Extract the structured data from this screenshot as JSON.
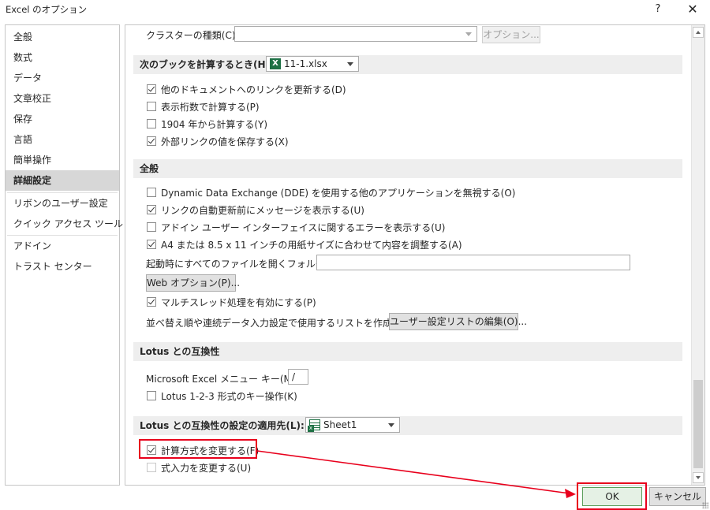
{
  "window": {
    "title": "Excel のオプション",
    "help": "?",
    "close": "✕"
  },
  "sidebar": {
    "items": [
      {
        "label": "全般"
      },
      {
        "label": "数式"
      },
      {
        "label": "データ"
      },
      {
        "label": "文章校正"
      },
      {
        "label": "保存"
      },
      {
        "label": "言語"
      },
      {
        "label": "簡単操作"
      },
      {
        "label": "詳細設定",
        "selected": true
      },
      {
        "label": "リボンのユーザー設定"
      },
      {
        "label": "クイック アクセス ツール バー"
      },
      {
        "label": "アドイン"
      },
      {
        "label": "トラスト センター"
      }
    ]
  },
  "content": {
    "cluster": {
      "label": "クラスターの種類(C):",
      "value": "",
      "options_button": "オプション..."
    },
    "workbook_section": {
      "title": "次のブックを計算するとき(H):",
      "workbook": "11-1.xlsx"
    },
    "workbook_options": [
      {
        "label": "他のドキュメントへのリンクを更新する(D)",
        "checked": true
      },
      {
        "label": "表示桁数で計算する(P)",
        "checked": false
      },
      {
        "label": "1904 年から計算する(Y)",
        "checked": false
      },
      {
        "label": "外部リンクの値を保存する(X)",
        "checked": true
      }
    ],
    "general_section": {
      "title": "全般"
    },
    "general_options": [
      {
        "label": "Dynamic Data Exchange (DDE) を使用する他のアプリケーションを無視する(O)",
        "checked": false
      },
      {
        "label": "リンクの自動更新前にメッセージを表示する(U)",
        "checked": true
      },
      {
        "label": "アドイン ユーザー インターフェイスに関するエラーを表示する(U)",
        "checked": false
      },
      {
        "label": "A4 または 8.5 x 11 インチの用紙サイズに合わせて内容を調整する(A)",
        "checked": true
      }
    ],
    "startup_folder": {
      "label": "起動時にすべてのファイルを開くフォルダー(L):",
      "value": ""
    },
    "web_options_button": "Web オプション(P)...",
    "multithread": {
      "label": "マルチスレッド処理を有効にする(P)",
      "checked": true
    },
    "custom_lists": {
      "label": "並べ替え順や連続データ入力設定で使用するリストを作成します:",
      "button": "ユーザー設定リストの編集(O)..."
    },
    "lotus_section": {
      "title": "Lotus との互換性"
    },
    "menu_key": {
      "label": "Microsoft Excel メニュー キー(M):",
      "value": "/"
    },
    "lotus_keys": {
      "label": "Lotus 1-2-3 形式のキー操作(K)",
      "checked": false
    },
    "lotus_settings_section": {
      "title": "Lotus との互換性の設定の適用先(L):",
      "sheet": "Sheet1"
    },
    "lotus_settings": [
      {
        "label": "計算方式を変更する(F)",
        "checked": true
      },
      {
        "label": "式入力を変更する(U)",
        "checked": false
      }
    ]
  },
  "buttons": {
    "ok": "OK",
    "cancel": "キャンセル"
  },
  "annotation": {
    "color": "#e8001c"
  }
}
